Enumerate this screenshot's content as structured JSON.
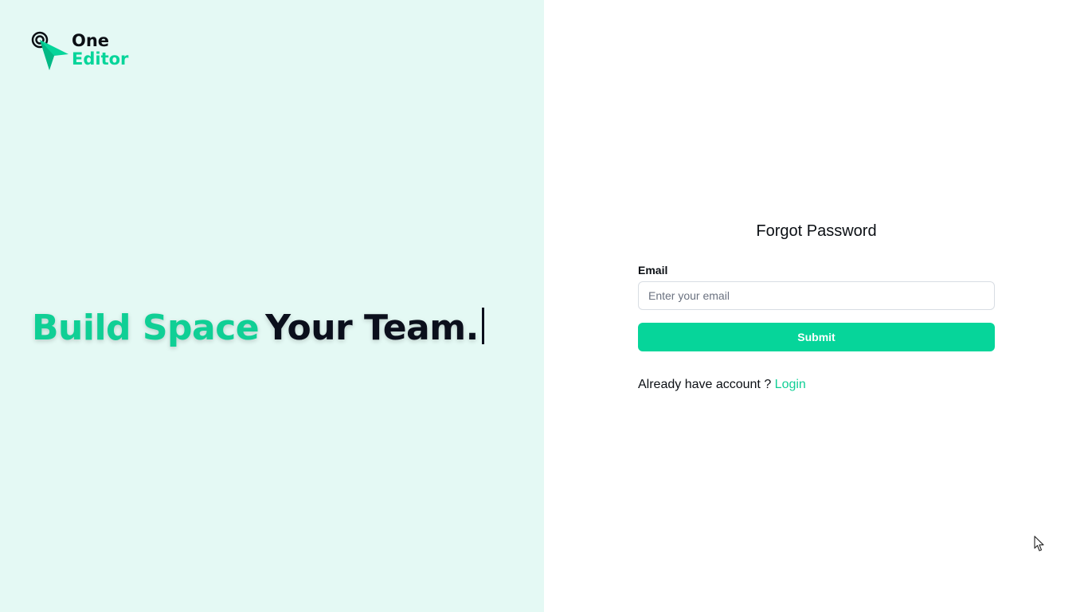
{
  "brand": {
    "line1": "One",
    "line2": "Editor",
    "icon": "logo-target-arrow-icon",
    "accent_color": "#06d59a"
  },
  "hero": {
    "highlight": "Build Space",
    "rest": "Your Team."
  },
  "form": {
    "title": "Forgot Password",
    "email_label": "Email",
    "email_placeholder": "Enter your email",
    "email_value": "",
    "submit_label": "Submit",
    "login_prompt": "Already have account ?",
    "login_link": "Login"
  },
  "colors": {
    "left_panel_bg": "#e4f9f4",
    "accent": "#06d59a",
    "text": "#0b0f14"
  }
}
